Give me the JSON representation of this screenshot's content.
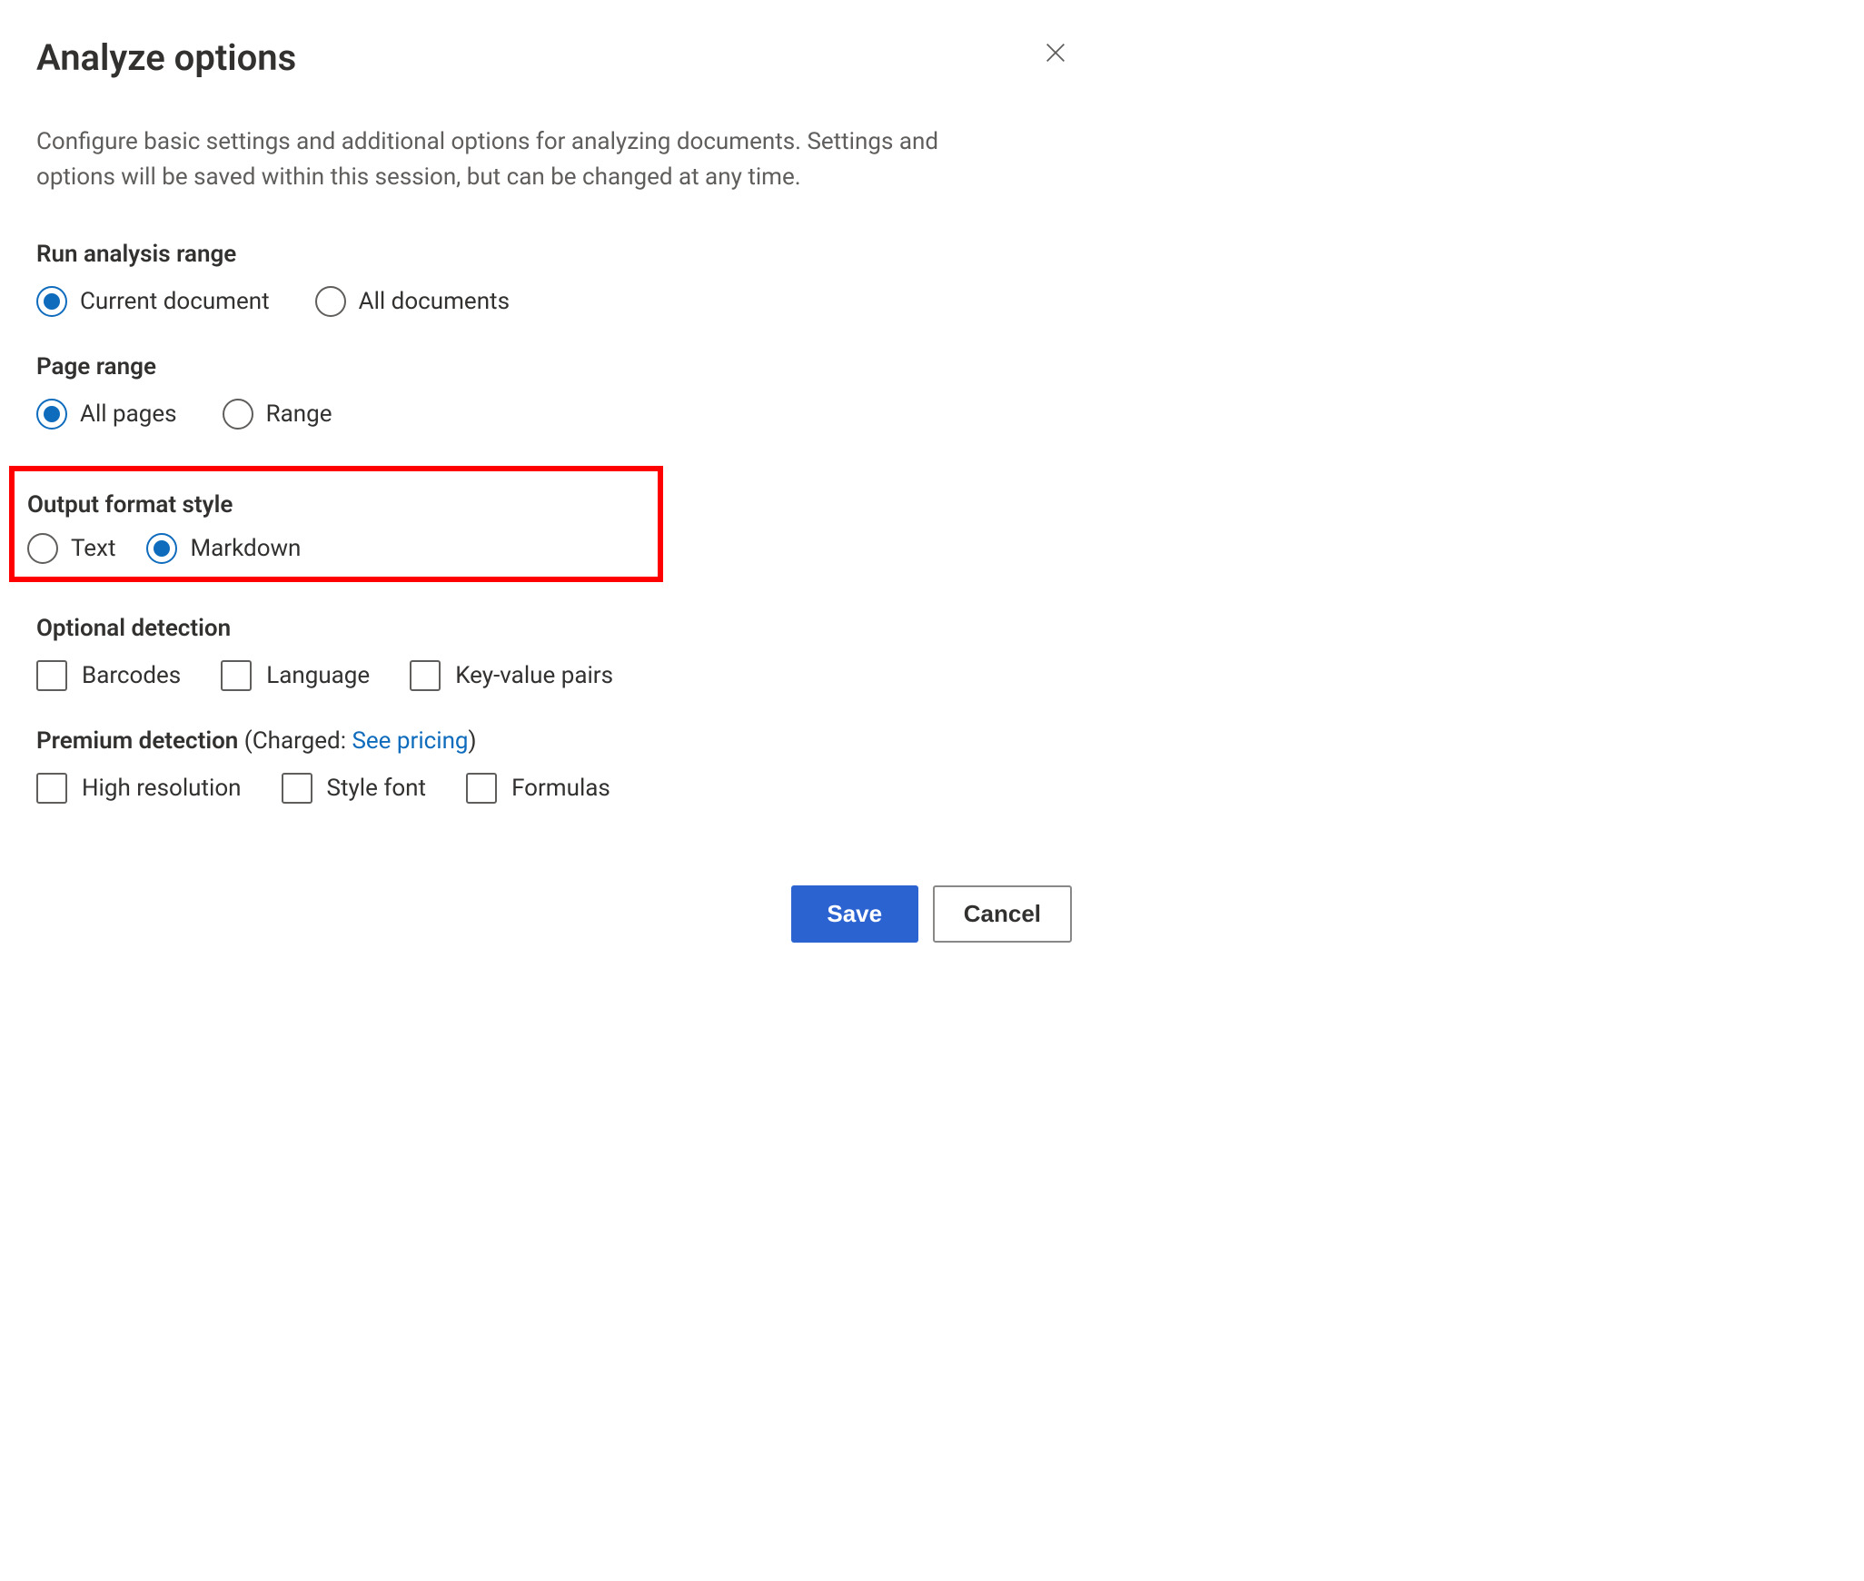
{
  "dialog": {
    "title": "Analyze options",
    "description": "Configure basic settings and additional options for analyzing documents. Settings and options will be saved within this session, but can be changed at any time."
  },
  "sections": {
    "analysisRange": {
      "label": "Run analysis range",
      "options": [
        {
          "label": "Current document",
          "selected": true
        },
        {
          "label": "All documents",
          "selected": false
        }
      ]
    },
    "pageRange": {
      "label": "Page range",
      "options": [
        {
          "label": "All pages",
          "selected": true
        },
        {
          "label": "Range",
          "selected": false
        }
      ]
    },
    "outputFormat": {
      "label": "Output format style",
      "options": [
        {
          "label": "Text",
          "selected": false
        },
        {
          "label": "Markdown",
          "selected": true
        }
      ]
    },
    "optionalDetection": {
      "label": "Optional detection",
      "options": [
        {
          "label": "Barcodes",
          "checked": false
        },
        {
          "label": "Language",
          "checked": false
        },
        {
          "label": "Key-value pairs",
          "checked": false
        }
      ]
    },
    "premiumDetection": {
      "labelPrefix": "Premium detection ",
      "chargedPrefix": "(Charged: ",
      "pricingLink": "See pricing",
      "chargedSuffix": ")",
      "options": [
        {
          "label": "High resolution",
          "checked": false
        },
        {
          "label": "Style font",
          "checked": false
        },
        {
          "label": "Formulas",
          "checked": false
        }
      ]
    }
  },
  "footer": {
    "saveLabel": "Save",
    "cancelLabel": "Cancel"
  }
}
